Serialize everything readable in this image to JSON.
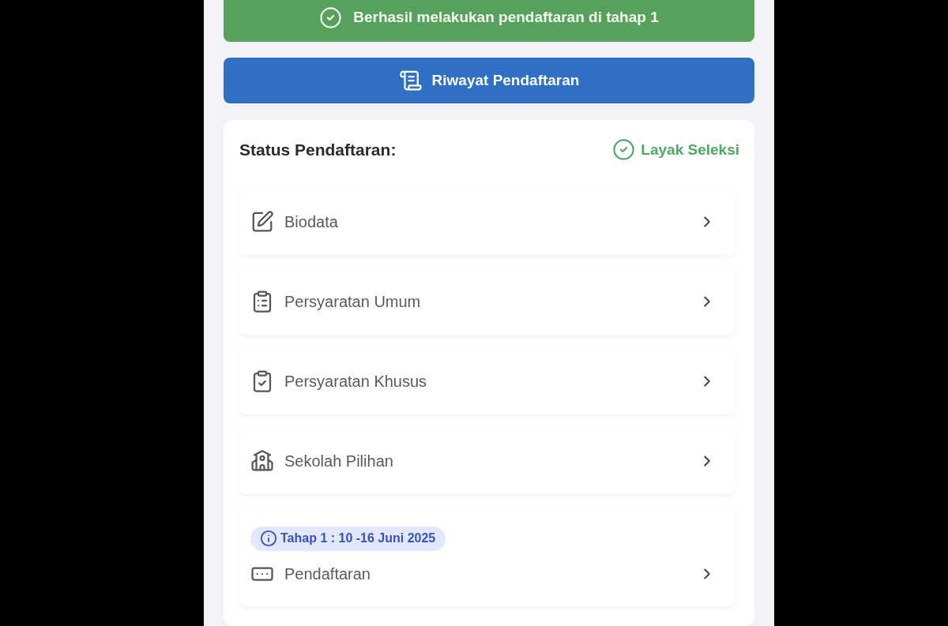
{
  "success_banner": {
    "text": "Berhasil melakukan pendaftaran di tahap 1"
  },
  "history_button": {
    "label": "Riwayat Pendaftaran"
  },
  "status_card": {
    "title": "Status Pendaftaran:",
    "status": "Layak Seleksi",
    "items": [
      {
        "label": "Biodata"
      },
      {
        "label": "Persyaratan Umum"
      },
      {
        "label": "Persyaratan Khusus"
      },
      {
        "label": "Sekolah Pilihan"
      },
      {
        "label": "Pendaftaran",
        "badge": "Tahap 1 : 10 -16 Juni 2025"
      }
    ]
  }
}
